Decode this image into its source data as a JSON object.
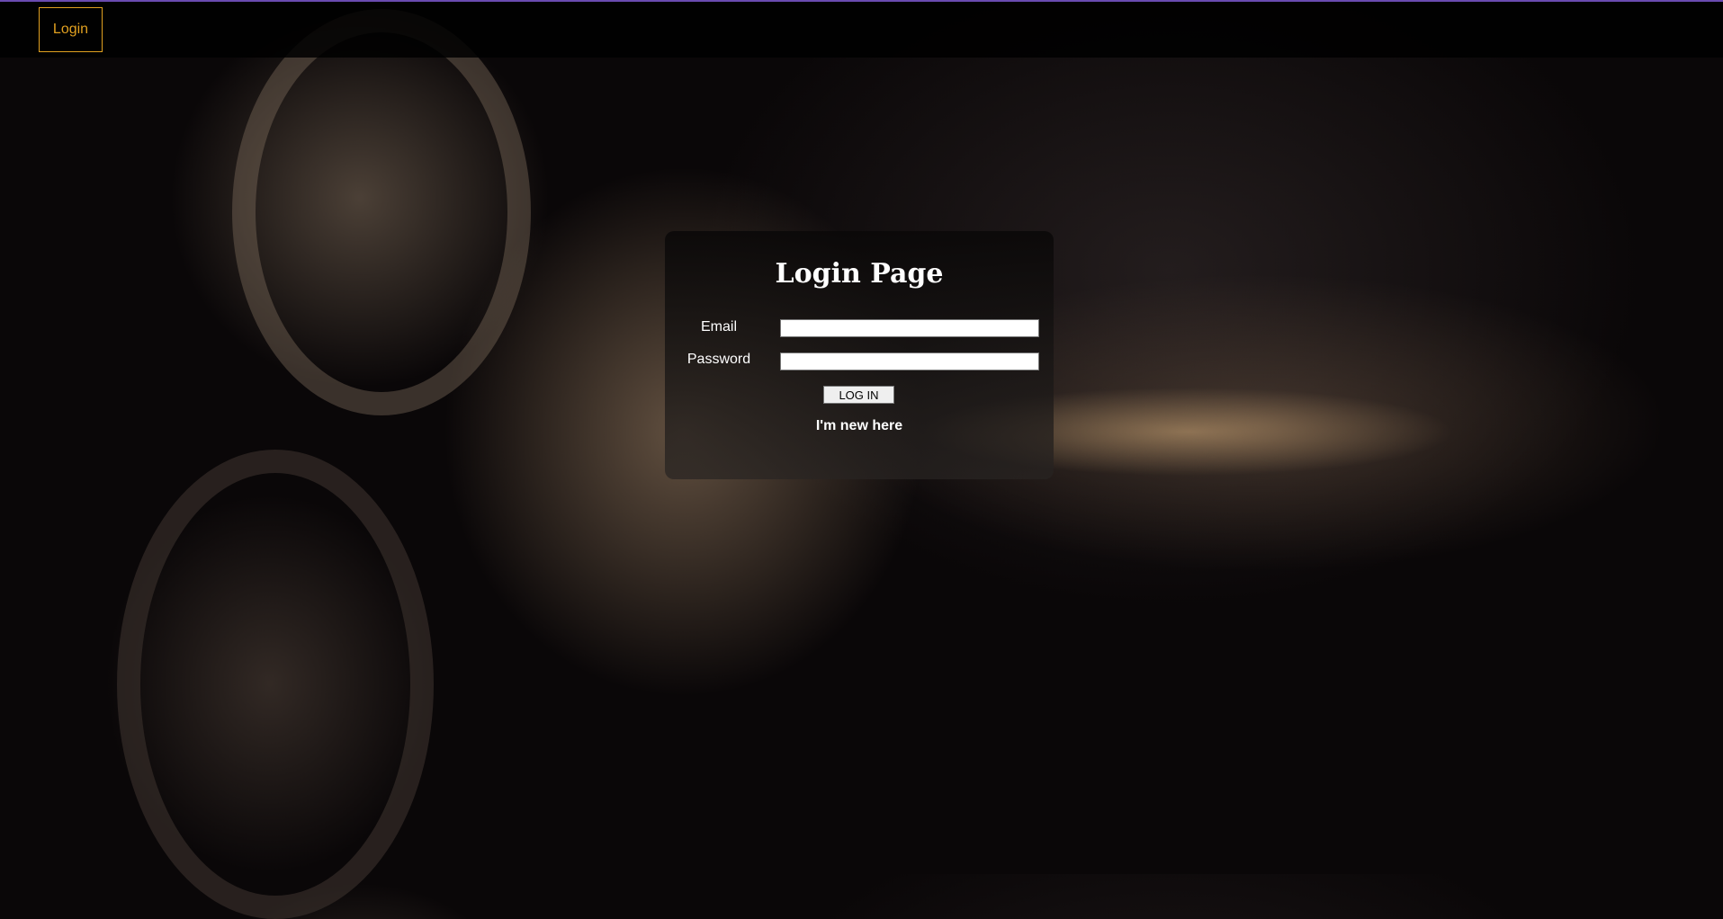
{
  "nav": {
    "login_label": "Login"
  },
  "login_panel": {
    "title": "Login Page",
    "email_label": "Email",
    "email_value": "",
    "password_label": "Password",
    "password_value": "",
    "submit_label": "LOG IN",
    "register_link": "I'm new here"
  },
  "colors": {
    "accent": "#e0a020",
    "top_line": "#6a4bb0"
  }
}
